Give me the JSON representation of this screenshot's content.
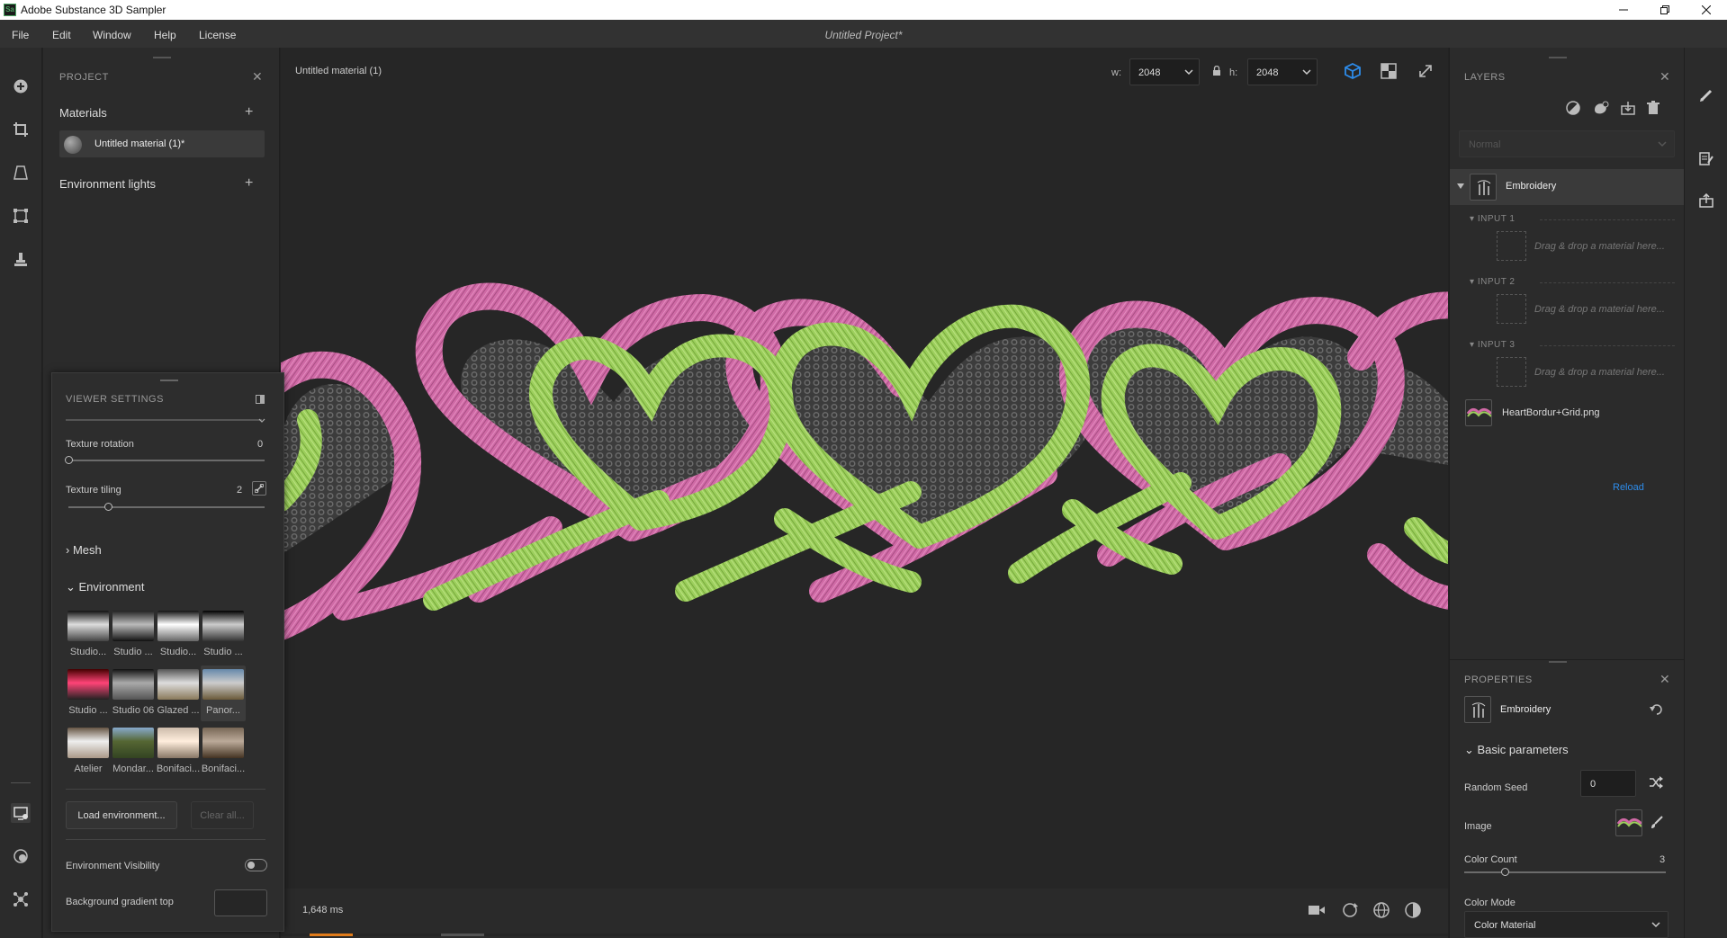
{
  "window": {
    "app_title": "Adobe Substance 3D Sampler",
    "logo_text": "Sa",
    "project_title": "Untitled Project*"
  },
  "menu": [
    "File",
    "Edit",
    "Window",
    "Help",
    "License"
  ],
  "project": {
    "header": "PROJECT",
    "materials_label": "Materials",
    "material_item": "Untitled material (1)*",
    "env_lights_label": "Environment lights"
  },
  "viewer": {
    "header": "VIEWER SETTINGS",
    "texture_rotation_label": "Texture rotation",
    "texture_rotation_value": "0",
    "texture_rotation_level": 0.0,
    "texture_tiling_label": "Texture tiling",
    "texture_tiling_value": "2",
    "texture_tiling_level": 0.2,
    "mesh_label": "Mesh",
    "environment_label": "Environment",
    "env_thumbs": [
      {
        "label": "Studio...",
        "colors": [
          "#111",
          "#ddd",
          "#444"
        ]
      },
      {
        "label": "Studio ...",
        "colors": [
          "#222",
          "#bbb",
          "#111"
        ]
      },
      {
        "label": "Studio...",
        "colors": [
          "#111",
          "#fff",
          "#666"
        ]
      },
      {
        "label": "Studio ...",
        "colors": [
          "#000",
          "#ccc",
          "#333"
        ]
      },
      {
        "label": "Studio ...",
        "colors": [
          "#400",
          "#f47",
          "#222"
        ]
      },
      {
        "label": "Studio 06",
        "colors": [
          "#111",
          "#aaa",
          "#555"
        ]
      },
      {
        "label": "Glazed ...",
        "colors": [
          "#555",
          "#ddd",
          "#8a7a5a"
        ]
      },
      {
        "label": "Panor...",
        "colors": [
          "#6688aa",
          "#cccccc",
          "#6b5a3a"
        ]
      },
      {
        "label": "Atelier",
        "colors": [
          "#665544",
          "#eeeeee",
          "#a98"
        ]
      },
      {
        "label": "Mondar...",
        "colors": [
          "#88aacc",
          "#556633",
          "#334422"
        ]
      },
      {
        "label": "Bonifaci...",
        "colors": [
          "#ccbbaa",
          "#ffeedd",
          "#887766"
        ]
      },
      {
        "label": "Bonifaci...",
        "colors": [
          "#776655",
          "#bbaa99",
          "#443322"
        ]
      }
    ],
    "load_env_button": "Load environment...",
    "clear_all_button": "Clear all...",
    "env_visibility_label": "Environment Visibility",
    "bg_gradient_top_label": "Background gradient top"
  },
  "viewport": {
    "material_name": "Untitled material (1)",
    "width_label": "w:",
    "width_value": "2048",
    "height_label": "h:",
    "height_value": "2048",
    "render_time": "1,648 ms"
  },
  "layers": {
    "header": "LAYERS",
    "blend_placeholder": "Normal",
    "filter_name": "Embroidery",
    "inputs": [
      {
        "head": "INPUT 1",
        "drop": "Drag & drop a material here..."
      },
      {
        "head": "INPUT 2",
        "drop": "Drag & drop a material here..."
      },
      {
        "head": "INPUT 3",
        "drop": "Drag & drop a material here..."
      }
    ],
    "image_layer": "HeartBordur+Grid.png",
    "reload_label": "Reload"
  },
  "properties": {
    "header": "PROPERTIES",
    "filter_name": "Embroidery",
    "section": "Basic parameters",
    "random_seed_label": "Random Seed",
    "random_seed_value": "0",
    "image_label": "Image",
    "color_count_label": "Color Count",
    "color_count_value": "3",
    "color_count_level": 0.2,
    "color_mode_label": "Color Mode",
    "color_mode_value": "Color Material"
  },
  "colors": {
    "accent_blue": "#2d8ceb",
    "pink_thread": "#d06aa6",
    "green_thread": "#9ccf5c",
    "mesh_gray": "#595959",
    "background": "#262626"
  }
}
